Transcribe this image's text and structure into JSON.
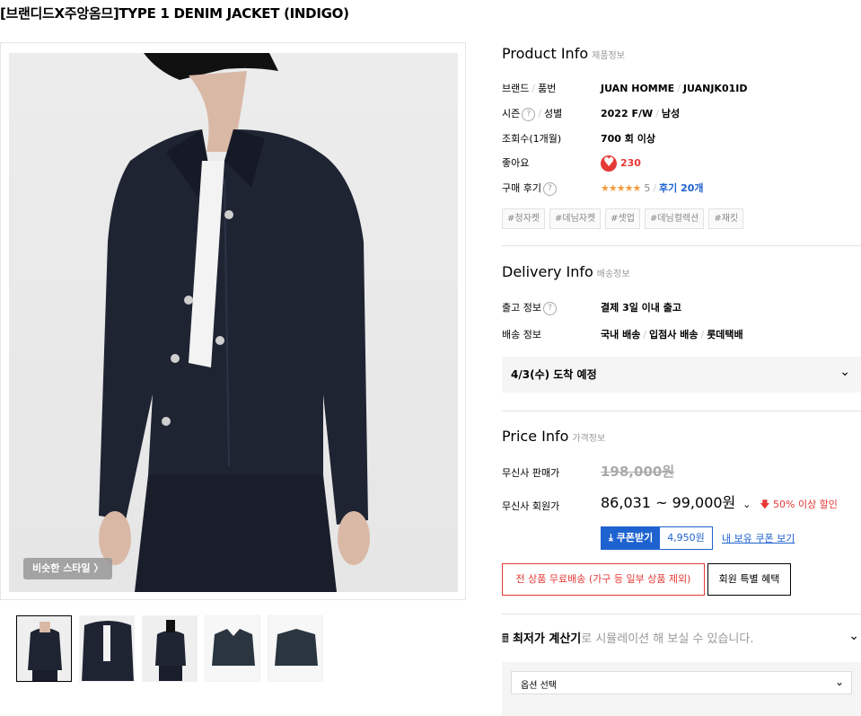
{
  "title": "[브랜디드X주앙옴므]TYPE 1 DENIM JACKET (INDIGO)",
  "gallery": {
    "similar_label": "비슷한 스타일 〉",
    "thumbnail_count": 5
  },
  "product_info": {
    "title": "Product Info",
    "title_ko": "제품정보",
    "rows": {
      "brand_label": "브랜드",
      "code_label": "품번",
      "brand": "JUAN HOMME",
      "code": "JUANJK01ID",
      "season_label": "시즌",
      "gender_label": "성별",
      "season": "2022 F/W",
      "gender": "남성",
      "views_label": "조회수(1개월)",
      "views": "700 회 이상",
      "likes_label": "좋아요",
      "likes": "230",
      "review_label": "구매 후기",
      "stars": "★★★★★",
      "score": "5",
      "review_link": "후기 20개"
    },
    "tags": [
      "#청자켓",
      "#데님자켓",
      "#셋업",
      "#데님컬렉션",
      "#재킷"
    ]
  },
  "delivery_info": {
    "title": "Delivery Info",
    "title_ko": "배송정보",
    "release_label": "출고 정보",
    "release": "결제 3일 이내 출고",
    "ship_label": "배송 정보",
    "ship_domestic": "국내 배송",
    "ship_store": "입점사 배송",
    "ship_courier": "롯데택배",
    "arrival": "4/3(수) 도착 예정"
  },
  "price_info": {
    "title": "Price Info",
    "title_ko": "가격정보",
    "sale_label": "무신사 판매가",
    "sale_price": "198,000원",
    "member_label": "무신사 회원가",
    "member_price": "86,031 ~ 99,000원",
    "discount": "50% 이상 할인",
    "coupon_get": "쿠폰받기",
    "coupon_amount": "4,950원",
    "coupon_link": "내 보유 쿠폰 보기",
    "free_ship": "전 상품 무료배송 (가구 등 일부 상품 제외)",
    "member_benefit": "회원 특별 혜택"
  },
  "calculator": {
    "bold": "최저가 계산기",
    "rest": "로 시뮬레이션 해 보실 수 있습니다."
  },
  "option": {
    "select": "옵션 선택"
  },
  "colors": {
    "accent_blue": "#1e62d0",
    "sale_red": "#e53935",
    "denim": "#1f2433"
  }
}
